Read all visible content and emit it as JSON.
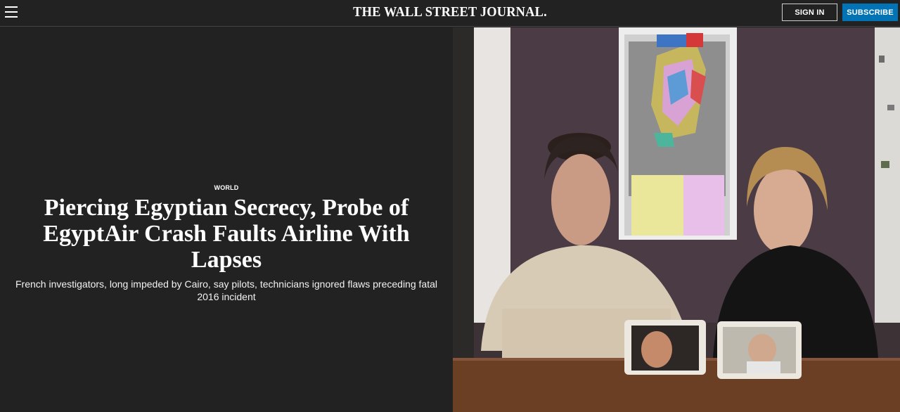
{
  "header": {
    "logo": "THE WALL STREET JOURNAL.",
    "signin_label": "SIGN IN",
    "subscribe_label": "SUBSCRIBE",
    "subscribe_color": "#0274b6"
  },
  "article": {
    "section": "WORLD",
    "headline": "Piercing Egyptian Secrecy, Probe of EgyptAir Crash Faults Airline With Lapses",
    "dek": "French investigators, long impeded by Cairo, say pilots, technicians ignored flaws preceding fatal 2016 incident"
  },
  "icons": {
    "menu": "menu-icon"
  }
}
